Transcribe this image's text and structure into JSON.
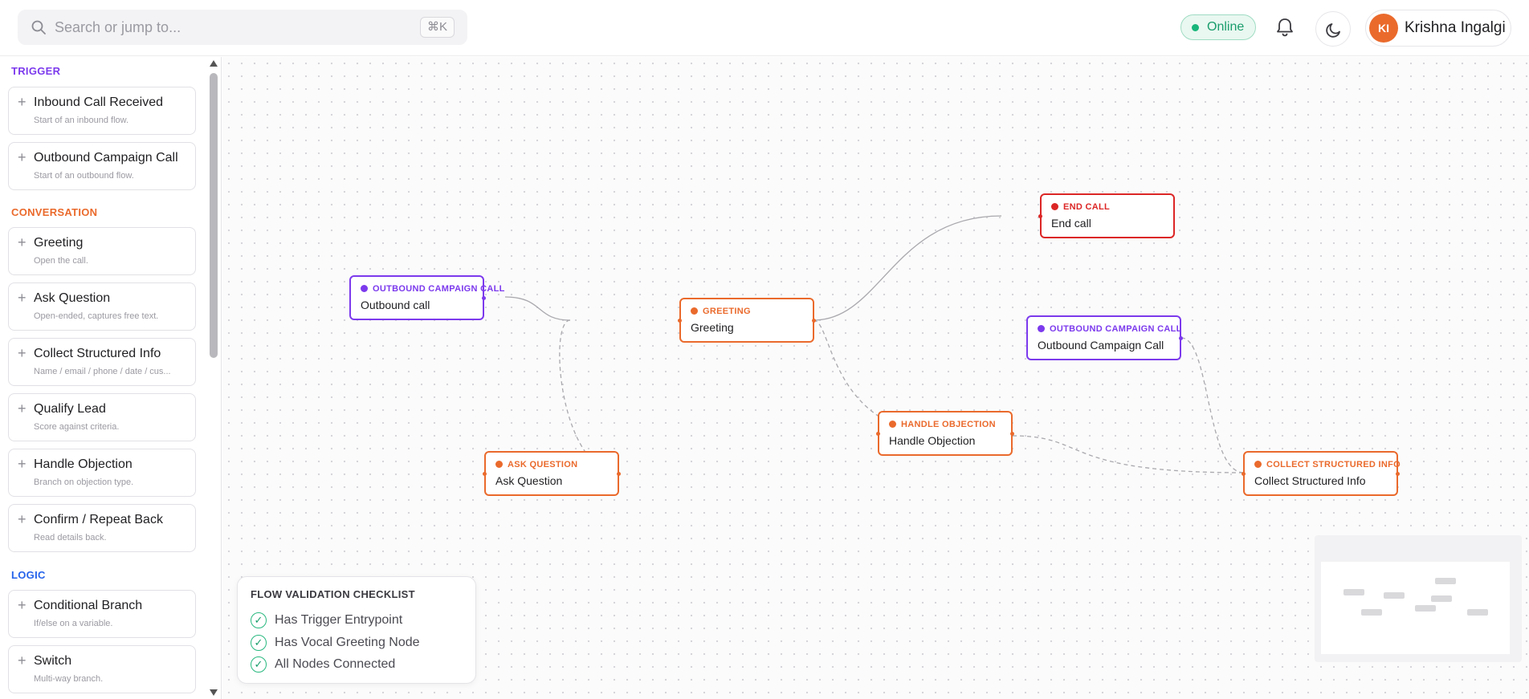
{
  "header": {
    "search_placeholder": "Search or jump to...",
    "search_shortcut": "⌘K",
    "status_label": "Online",
    "user_initials": "KI",
    "user_name": "Krishna Ingalgi"
  },
  "colors": {
    "trigger": "#7c3aed",
    "conversation": "#ea6a2c",
    "logic": "#2563eb",
    "end": "#dc2626",
    "online": "#17b57a"
  },
  "sidebar": {
    "sections": [
      {
        "title": "TRIGGER",
        "items": [
          {
            "title": "Inbound Call Received",
            "desc": "Start of an inbound flow."
          },
          {
            "title": "Outbound Campaign Call",
            "desc": "Start of an outbound flow."
          }
        ]
      },
      {
        "title": "CONVERSATION",
        "items": [
          {
            "title": "Greeting",
            "desc": "Open the call."
          },
          {
            "title": "Ask Question",
            "desc": "Open-ended, captures free text."
          },
          {
            "title": "Collect Structured Info",
            "desc": "Name / email / phone / date / cus..."
          },
          {
            "title": "Qualify Lead",
            "desc": "Score against criteria."
          },
          {
            "title": "Handle Objection",
            "desc": "Branch on objection type."
          },
          {
            "title": "Confirm / Repeat Back",
            "desc": "Read details back."
          }
        ]
      },
      {
        "title": "LOGIC",
        "items": [
          {
            "title": "Conditional Branch",
            "desc": "If/else on a variable."
          },
          {
            "title": "Switch",
            "desc": "Multi-way branch."
          }
        ]
      }
    ]
  },
  "canvas": {
    "nodes": {
      "outbound_call": {
        "type": "OUTBOUND CAMPAIGN CALL",
        "label": "Outbound call"
      },
      "greeting": {
        "type": "GREETING",
        "label": "Greeting"
      },
      "end_call": {
        "type": "END CALL",
        "label": "End call"
      },
      "outbound_campaign": {
        "type": "OUTBOUND CAMPAIGN CALL",
        "label": "Outbound Campaign Call"
      },
      "ask_question": {
        "type": "ASK QUESTION",
        "label": "Ask Question"
      },
      "handle_objection": {
        "type": "HANDLE OBJECTION",
        "label": "Handle Objection"
      },
      "collect_info": {
        "type": "COLLECT STRUCTURED INFO",
        "label": "Collect Structured Info"
      }
    },
    "checklist": {
      "title": "FLOW VALIDATION CHECKLIST",
      "items": [
        "Has Trigger Entrypoint",
        "Has Vocal Greeting Node",
        "All Nodes Connected"
      ]
    }
  }
}
